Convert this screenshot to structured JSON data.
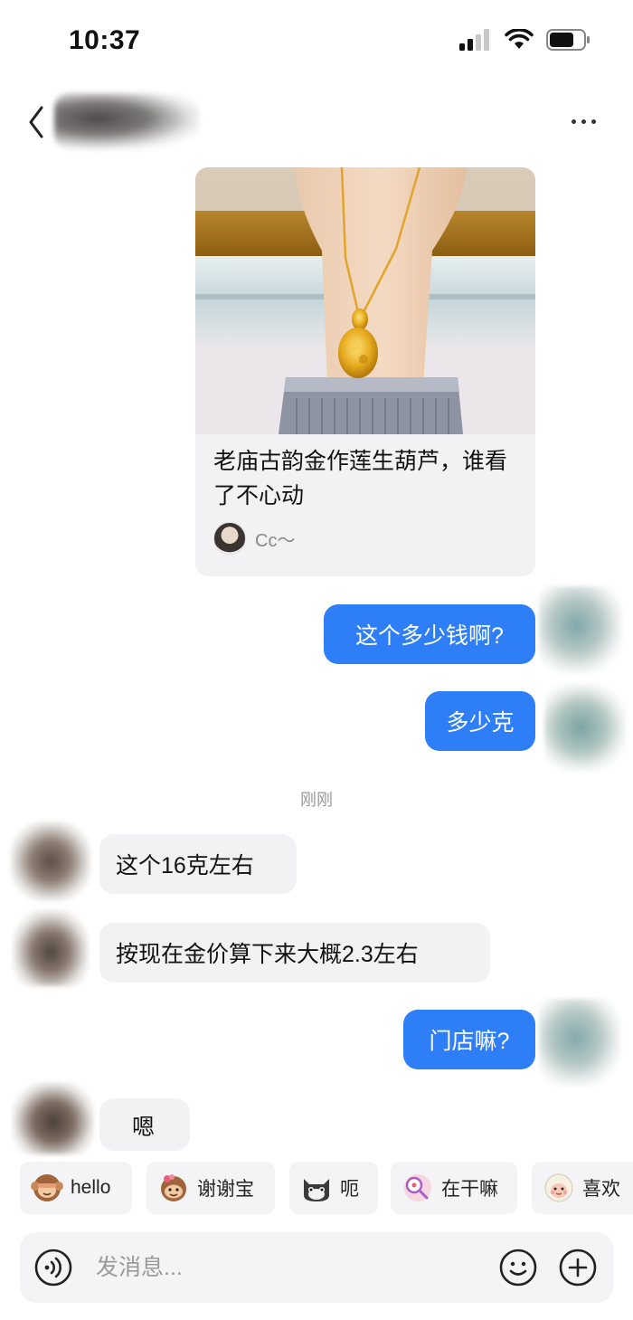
{
  "status_bar": {
    "time": "10:37"
  },
  "card": {
    "title": "老庙古韵金作莲生葫芦，谁看了不心动",
    "author": "Cc～"
  },
  "messages": [
    {
      "side": "right",
      "text": "这个多少钱啊?"
    },
    {
      "side": "right",
      "text": "多少克"
    },
    {
      "side": "left",
      "text": "这个16克左右"
    },
    {
      "side": "left",
      "text": "按现在金价算下来大概2.3左右"
    },
    {
      "side": "right",
      "text": "门店嘛?"
    },
    {
      "side": "left",
      "text": "嗯"
    }
  ],
  "timestamp": "刚刚",
  "quick_replies": [
    {
      "label": "hello",
      "icon": "monkey-icon"
    },
    {
      "label": "谢谢宝",
      "icon": "monkey-flower-icon"
    },
    {
      "label": "呃",
      "icon": "cat-icon"
    },
    {
      "label": "在干嘛",
      "icon": "magnifier-pig-icon"
    },
    {
      "label": "喜欢",
      "icon": "sheep-icon"
    }
  ],
  "input": {
    "placeholder": "发消息..."
  },
  "colors": {
    "accent": "#2d7ef7",
    "bubble_left": "#f2f2f4"
  }
}
